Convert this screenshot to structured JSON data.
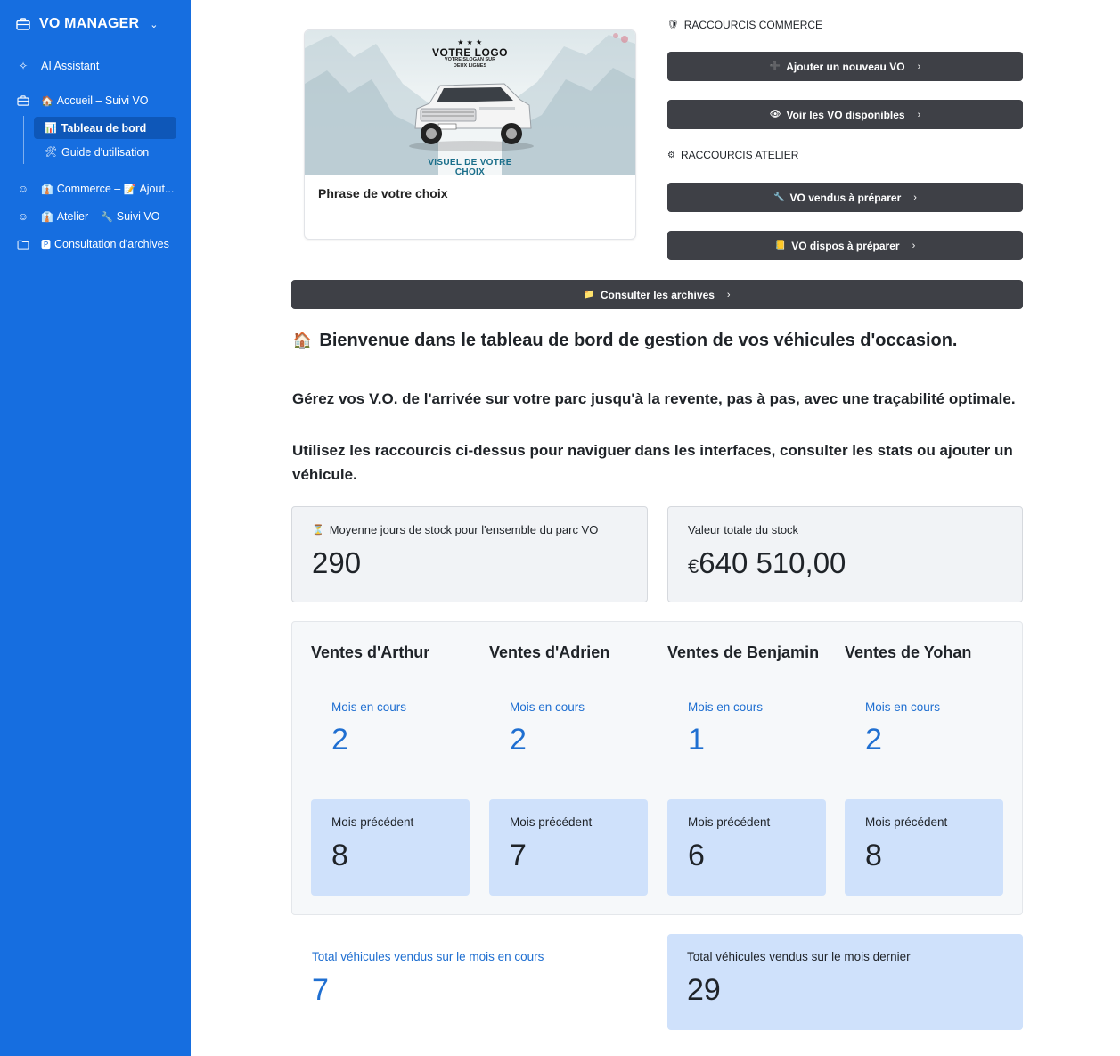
{
  "app": {
    "title": "VO MANAGER"
  },
  "sidebar": {
    "ai_assistant": "AI Assistant",
    "accueil": {
      "emoji": "🏠",
      "label": "Accueil – Suivi VO"
    },
    "sub_items": [
      {
        "emoji": "📊",
        "label": "Tableau de bord"
      },
      {
        "emoji": "🛠",
        "label": "Guide d'utilisation"
      }
    ],
    "commerce": {
      "emoji": "👔",
      "label": "Commerce –",
      "emoji2": "📝",
      "label2": "Ajout..."
    },
    "atelier": {
      "emoji": "👔",
      "label": "Atelier –",
      "emoji2": "🔧",
      "label2": "Suivi VO"
    },
    "archives": {
      "emoji": "🅿",
      "label": "Consultation d'archives"
    }
  },
  "logo_card": {
    "stars": "★ ★ ★",
    "logo": "VOTRE LOGO",
    "slogan_line1": "VOTRE SLOGAN SUR",
    "slogan_line2": "DEUX LIGNES",
    "visuel_line1": "VISUEL DE VOTRE",
    "visuel_line2": "CHOIX",
    "phrase": "Phrase de votre choix"
  },
  "shortcuts": {
    "commerce_label": "RACCOURCIS COMMERCE",
    "commerce_emoji": "🛡",
    "atelier_label": "RACCOURCIS ATELIER",
    "atelier_emoji": "⚙",
    "arrow": "›",
    "buttons": {
      "add_vo": {
        "emoji": "➕",
        "label": "Ajouter un nouveau VO"
      },
      "view_vo": {
        "emoji": "👁",
        "label": "Voir les VO disponibles"
      },
      "sold_vo": {
        "emoji": "🔧",
        "label": "VO vendus à préparer"
      },
      "dispo_vo": {
        "emoji": "📒",
        "label": "VO dispos à préparer"
      },
      "archives": {
        "emoji": "📁",
        "label": "Consulter les archives"
      }
    }
  },
  "welcome": {
    "emoji": "🏠",
    "title": "Bienvenue dans le tableau de bord de gestion de vos véhicules d'occasion.",
    "intro1": "Gérez vos V.O. de l'arrivée sur votre parc jusqu'à la revente, pas à pas, avec une traçabilité optimale.",
    "intro2": "Utilisez les raccourcis ci-dessus pour naviguer dans les interfaces, consulter les stats ou ajouter un véhicule."
  },
  "stats": {
    "avg_days": {
      "emoji": "⏳",
      "label": "Moyenne jours de stock pour l'ensemble du parc VO",
      "value": "290"
    },
    "stock_value": {
      "label": "Valeur totale du stock",
      "currency": "€",
      "value": "640 510,00"
    }
  },
  "sales": {
    "current_label": "Mois en cours",
    "previous_label": "Mois précédent",
    "sellers": [
      {
        "name": "Ventes d'Arthur",
        "current": "2",
        "previous": "8"
      },
      {
        "name": "Ventes d'Adrien",
        "current": "2",
        "previous": "7"
      },
      {
        "name": "Ventes de Benjamin",
        "current": "1",
        "previous": "6"
      },
      {
        "name": "Ventes de Yohan",
        "current": "2",
        "previous": "8"
      }
    ]
  },
  "totals": {
    "current": {
      "label": "Total véhicules vendus sur le mois en cours",
      "value": "7"
    },
    "previous": {
      "label": "Total véhicules vendus sur le mois dernier",
      "value": "29"
    }
  },
  "colors": {
    "sidebar": "#166ee0",
    "button": "#3e4046",
    "accent_blue": "#1f6fd1",
    "light_blue": "#cfe1fb"
  }
}
